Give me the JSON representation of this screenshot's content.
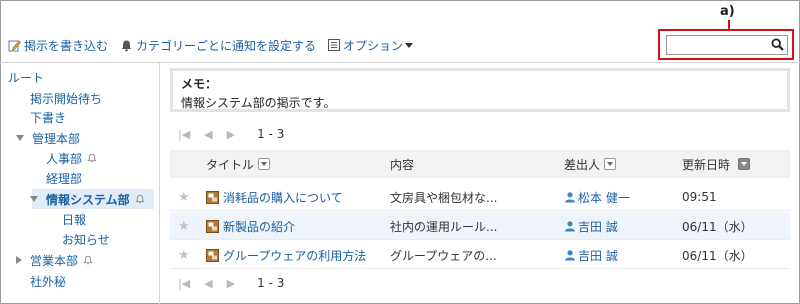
{
  "annotation": {
    "label": "a)"
  },
  "toolbar": {
    "post_label": "掲示を書き込む",
    "notify_label": "カテゴリーごとに通知を設定する",
    "options_label": "オプション"
  },
  "search": {
    "value": "",
    "placeholder": ""
  },
  "sidebar": {
    "items": [
      {
        "label": "ルート"
      },
      {
        "label": "掲示開始待ち"
      },
      {
        "label": "下書き"
      },
      {
        "label": "管理本部"
      },
      {
        "label": "人事部"
      },
      {
        "label": "経理部"
      },
      {
        "label": "情報システム部"
      },
      {
        "label": "日報"
      },
      {
        "label": "お知らせ"
      },
      {
        "label": "営業本部"
      },
      {
        "label": "社外秘"
      }
    ]
  },
  "memo": {
    "title": "メモ：",
    "body": "情報システム部の掲示です。"
  },
  "pager": {
    "range": "1 - 3"
  },
  "table": {
    "headers": {
      "title": "タイトル",
      "content": "内容",
      "sender": "差出人",
      "updated": "更新日時"
    },
    "rows": [
      {
        "title": "消耗品の購入について",
        "content": "文房具や梱包材な...",
        "sender": "松本 健一",
        "date": "09:51"
      },
      {
        "title": "新製品の紹介",
        "content": "社内の運用ルール...",
        "sender": "吉田 誠",
        "date": "06/11（水）"
      },
      {
        "title": "グループウェアの利用方法",
        "content": "グループウェアの...",
        "sender": "吉田 誠",
        "date": "06/11（水）"
      }
    ]
  },
  "colors": {
    "link": "#1b5fa5",
    "highlight": "#d0121b",
    "selected_bg": "#e2ecf7",
    "alt_row_bg": "#eef4fa"
  }
}
